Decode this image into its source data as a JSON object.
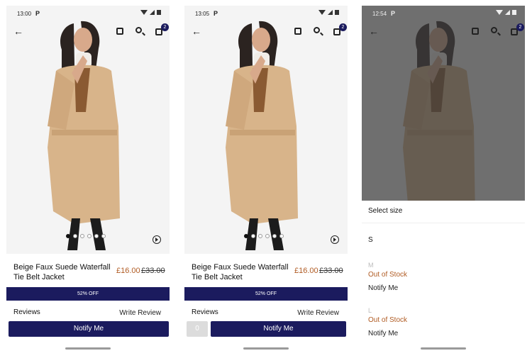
{
  "screens": [
    {
      "status": {
        "time": "13:00",
        "carrier": "P"
      },
      "badge_count": "2",
      "product": {
        "title": "Beige Faux Suede Waterfall Tie Belt Jacket",
        "price": "£16.00",
        "old_price": "£33.00"
      },
      "discount": "52% OFF",
      "reviews_label": "Reviews",
      "write_review": "Write Review",
      "notify_label": "Notify Me"
    },
    {
      "status": {
        "time": "13:05",
        "carrier": "P"
      },
      "badge_count": "2",
      "product": {
        "title": "Beige Faux Suede Waterfall Tie Belt Jacket",
        "price": "£16.00",
        "old_price": "£33.00"
      },
      "discount": "52% OFF",
      "reviews_label": "Reviews",
      "write_review": "Write Review",
      "quantity": "0",
      "notify_label": "Notify Me"
    },
    {
      "status": {
        "time": "12:54",
        "carrier": "P"
      },
      "badge_count": "2",
      "size_sheet": {
        "title": "Select size",
        "sizes": [
          {
            "size": "S"
          },
          {
            "size": "M",
            "status": "Out of Stock",
            "action": "Notify Me"
          },
          {
            "size": "L",
            "status": "Out of Stock",
            "action": "Notify Me"
          }
        ]
      }
    }
  ],
  "colors": {
    "brand_navy": "#1b1b5e",
    "price_orange": "#b05b23"
  }
}
